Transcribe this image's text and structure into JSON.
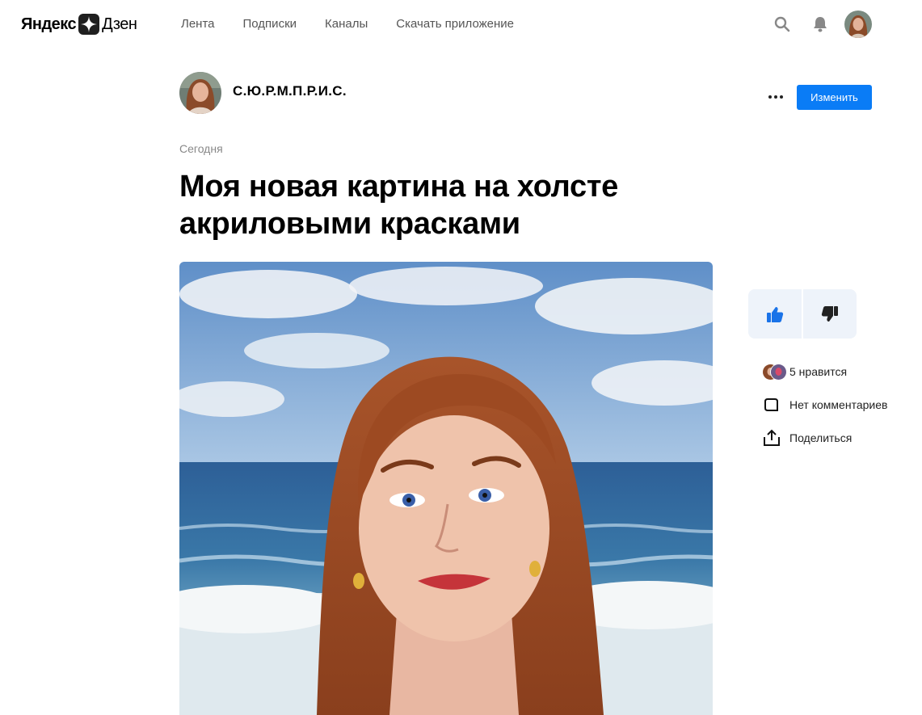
{
  "header": {
    "logo": {
      "left": "Яндекс",
      "right": "Дзен"
    },
    "nav": [
      "Лента",
      "Подписки",
      "Каналы",
      "Скачать приложение"
    ],
    "icons": [
      "search-icon",
      "bell-icon",
      "user-avatar"
    ]
  },
  "channel": {
    "name": "С.Ю.Р.М.П.Р.И.С.",
    "edit_label": "Изменить"
  },
  "article": {
    "date": "Сегодня",
    "title": "Моя новая картина на холсте акриловыми красками"
  },
  "sidebar": {
    "likes_text": "5 нравится",
    "comments_text": "Нет комментариев",
    "share_text": "Поделиться"
  },
  "colors": {
    "accent": "#0a7cf6",
    "vote_bg": "#eef3fa"
  }
}
